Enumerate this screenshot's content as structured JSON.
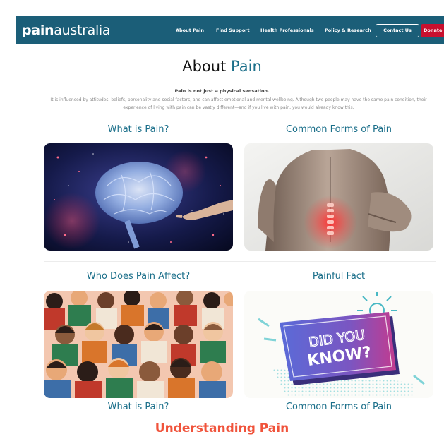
{
  "header": {
    "logo_bold": "pain",
    "logo_light": "australia",
    "nav": [
      "About Pain",
      "Find Support",
      "Health Professionals",
      "Policy & Research"
    ],
    "contact_label": "Contact Us",
    "donate_label": "Donate",
    "bg_color": "#1b5e78",
    "donate_color": "#c8102e"
  },
  "page": {
    "title_first": "About",
    "title_accent": "Pain",
    "intro_strong": "Pain is not just a physical sensation.",
    "intro_text": "It is influenced by attitudes, beliefs, personality and social factors, and can affect emotional and mental wellbeing. Although two people may have the same pain condition, their experience of living with pain can be vastly different—and if you live with pain, you would already know this.",
    "accent_color": "#1b6f8a"
  },
  "cards": [
    {
      "title": "What is Pain?",
      "image": "brain-hand-image"
    },
    {
      "title": "Common Forms of Pain",
      "image": "back-pain-image"
    },
    {
      "title": "Who Does Pain Affect?",
      "image": "crowd-illustration"
    },
    {
      "title": "Painful Fact",
      "image": "did-you-know-image"
    }
  ],
  "did_you_know": {
    "line1": "DID YOU",
    "line2": "KNOW?"
  },
  "bottom_labels": [
    "What is Pain?",
    "Common Forms of Pain"
  ],
  "footer_title": "Understanding Pain",
  "footer_color": "#f0533b"
}
